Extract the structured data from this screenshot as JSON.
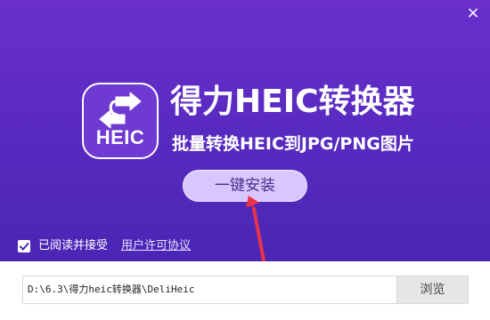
{
  "window": {
    "close_symbol": "×"
  },
  "app": {
    "logo_text": "HEIC",
    "title": "得力HEIC转换器",
    "subtitle": "批量转换HEIC到JPG/PNG图片"
  },
  "install": {
    "button_label": "一键安装"
  },
  "agreement": {
    "checked": true,
    "label": "已阅读并接受",
    "link_label": "用户许可协议"
  },
  "install_path": {
    "value": "D:\\6.3\\得力heic转换器\\DeliHeic",
    "browse_label": "浏览"
  },
  "colors": {
    "background_top": "#6a2fcb",
    "background_bottom": "#4a26b3",
    "install_button": "#d9c6ff",
    "arrow": "#e8334a"
  },
  "icons": [
    "close-icon",
    "swap-arrows-icon",
    "checkmark-icon",
    "annotation-arrow-icon"
  ]
}
